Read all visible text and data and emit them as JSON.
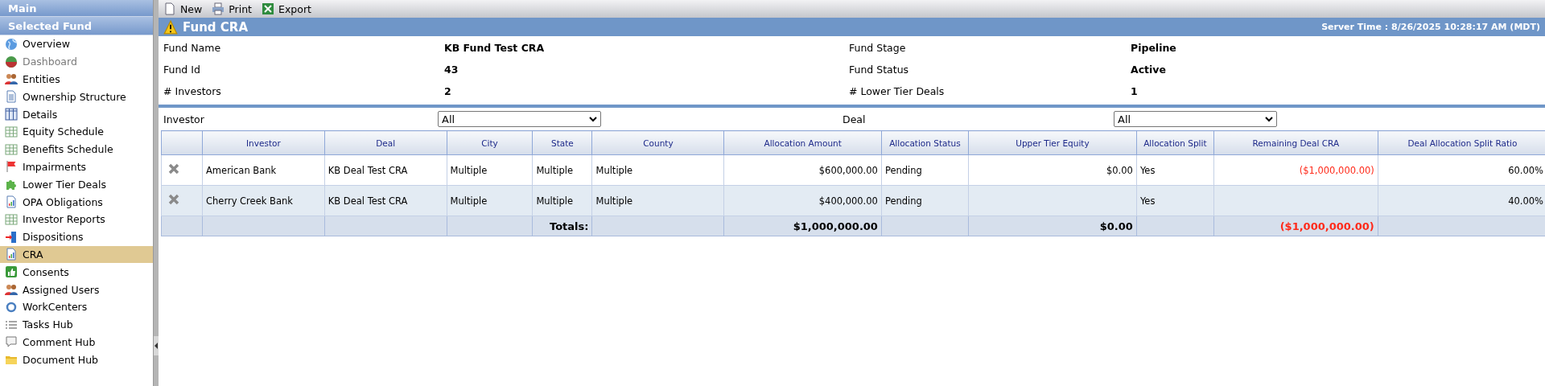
{
  "sidebar": {
    "headers": [
      "Main",
      "Selected Fund"
    ],
    "items": [
      {
        "label": "Overview",
        "selected": false,
        "disabled": false
      },
      {
        "label": "Dashboard",
        "selected": false,
        "disabled": true
      },
      {
        "label": "Entities",
        "selected": false,
        "disabled": false
      },
      {
        "label": "Ownership Structure",
        "selected": false,
        "disabled": false
      },
      {
        "label": "Details",
        "selected": false,
        "disabled": false
      },
      {
        "label": "Equity Schedule",
        "selected": false,
        "disabled": false
      },
      {
        "label": "Benefits Schedule",
        "selected": false,
        "disabled": false
      },
      {
        "label": "Impairments",
        "selected": false,
        "disabled": false
      },
      {
        "label": "Lower Tier Deals",
        "selected": false,
        "disabled": false
      },
      {
        "label": "OPA Obligations",
        "selected": false,
        "disabled": false
      },
      {
        "label": "Investor Reports",
        "selected": false,
        "disabled": false
      },
      {
        "label": "Dispositions",
        "selected": false,
        "disabled": false
      },
      {
        "label": "CRA",
        "selected": true,
        "disabled": false
      },
      {
        "label": "Consents",
        "selected": false,
        "disabled": false
      },
      {
        "label": "Assigned Users",
        "selected": false,
        "disabled": false
      },
      {
        "label": "WorkCenters",
        "selected": false,
        "disabled": false
      },
      {
        "label": "Tasks Hub",
        "selected": false,
        "disabled": false
      },
      {
        "label": "Comment Hub",
        "selected": false,
        "disabled": false
      },
      {
        "label": "Document Hub",
        "selected": false,
        "disabled": false
      }
    ]
  },
  "toolbar": [
    "New",
    "Print",
    "Export"
  ],
  "header": {
    "title": "Fund CRA",
    "server_time": "Server Time : 8/26/2025 10:28:17 AM (MDT)"
  },
  "info": [
    {
      "label": "Fund Name",
      "value": "KB Fund Test CRA",
      "label_2": "Fund Stage",
      "value_2": "Pipeline"
    },
    {
      "label": "Fund Id",
      "value": "43",
      "label_2": "Fund Status",
      "value_2": "Active"
    },
    {
      "label": "# Investors",
      "value": "2",
      "label_2": "# Lower Tier Deals",
      "value_2": "1"
    }
  ],
  "filters": [
    {
      "label": "Investor",
      "value": "All"
    },
    {
      "label": "Deal",
      "value": "All"
    }
  ],
  "table": {
    "columns": [
      {
        "label": "Investor",
        "numeric": false
      },
      {
        "label": "Deal",
        "numeric": false
      },
      {
        "label": "City",
        "numeric": false
      },
      {
        "label": "State",
        "numeric": false
      },
      {
        "label": "County",
        "numeric": false
      },
      {
        "label": "Allocation Amount",
        "numeric": true
      },
      {
        "label": "Allocation Status",
        "numeric": false
      },
      {
        "label": "Upper Tier Equity",
        "numeric": true
      },
      {
        "label": "Allocation Split",
        "numeric": false
      },
      {
        "label": "Remaining Deal CRA",
        "numeric": true
      },
      {
        "label": "Deal Allocation Split Ratio",
        "numeric": true
      }
    ],
    "rows": [
      {
        "deletable": true,
        "cells": [
          {
            "text": "American Bank",
            "negative": false
          },
          {
            "text": "KB Deal Test CRA",
            "negative": false
          },
          {
            "text": "Multiple",
            "negative": false
          },
          {
            "text": "Multiple",
            "negative": false
          },
          {
            "text": "Multiple",
            "negative": false
          },
          {
            "text": "$600,000.00",
            "negative": false
          },
          {
            "text": "Pending",
            "negative": false
          },
          {
            "text": "$0.00",
            "negative": false
          },
          {
            "text": "Yes",
            "negative": false
          },
          {
            "text": "($1,000,000.00)",
            "negative": true
          },
          {
            "text": "60.00%",
            "negative": false
          }
        ]
      },
      {
        "deletable": true,
        "cells": [
          {
            "text": "Cherry Creek Bank",
            "negative": false
          },
          {
            "text": "KB Deal Test CRA",
            "negative": false
          },
          {
            "text": "Multiple",
            "negative": false
          },
          {
            "text": "Multiple",
            "negative": false
          },
          {
            "text": "Multiple",
            "negative": false
          },
          {
            "text": "$400,000.00",
            "negative": false
          },
          {
            "text": "Pending",
            "negative": false
          },
          null,
          {
            "text": "Yes",
            "negative": false
          },
          null,
          {
            "text": "40.00%",
            "negative": false
          }
        ]
      }
    ],
    "totals": {
      "label": "Totals:",
      "allocation_amount": "$1,000,000.00",
      "upper_tier_equity": "$0.00",
      "remaining_deal_cra": "($1,000,000.00)",
      "remaining_negative": true
    }
  }
}
